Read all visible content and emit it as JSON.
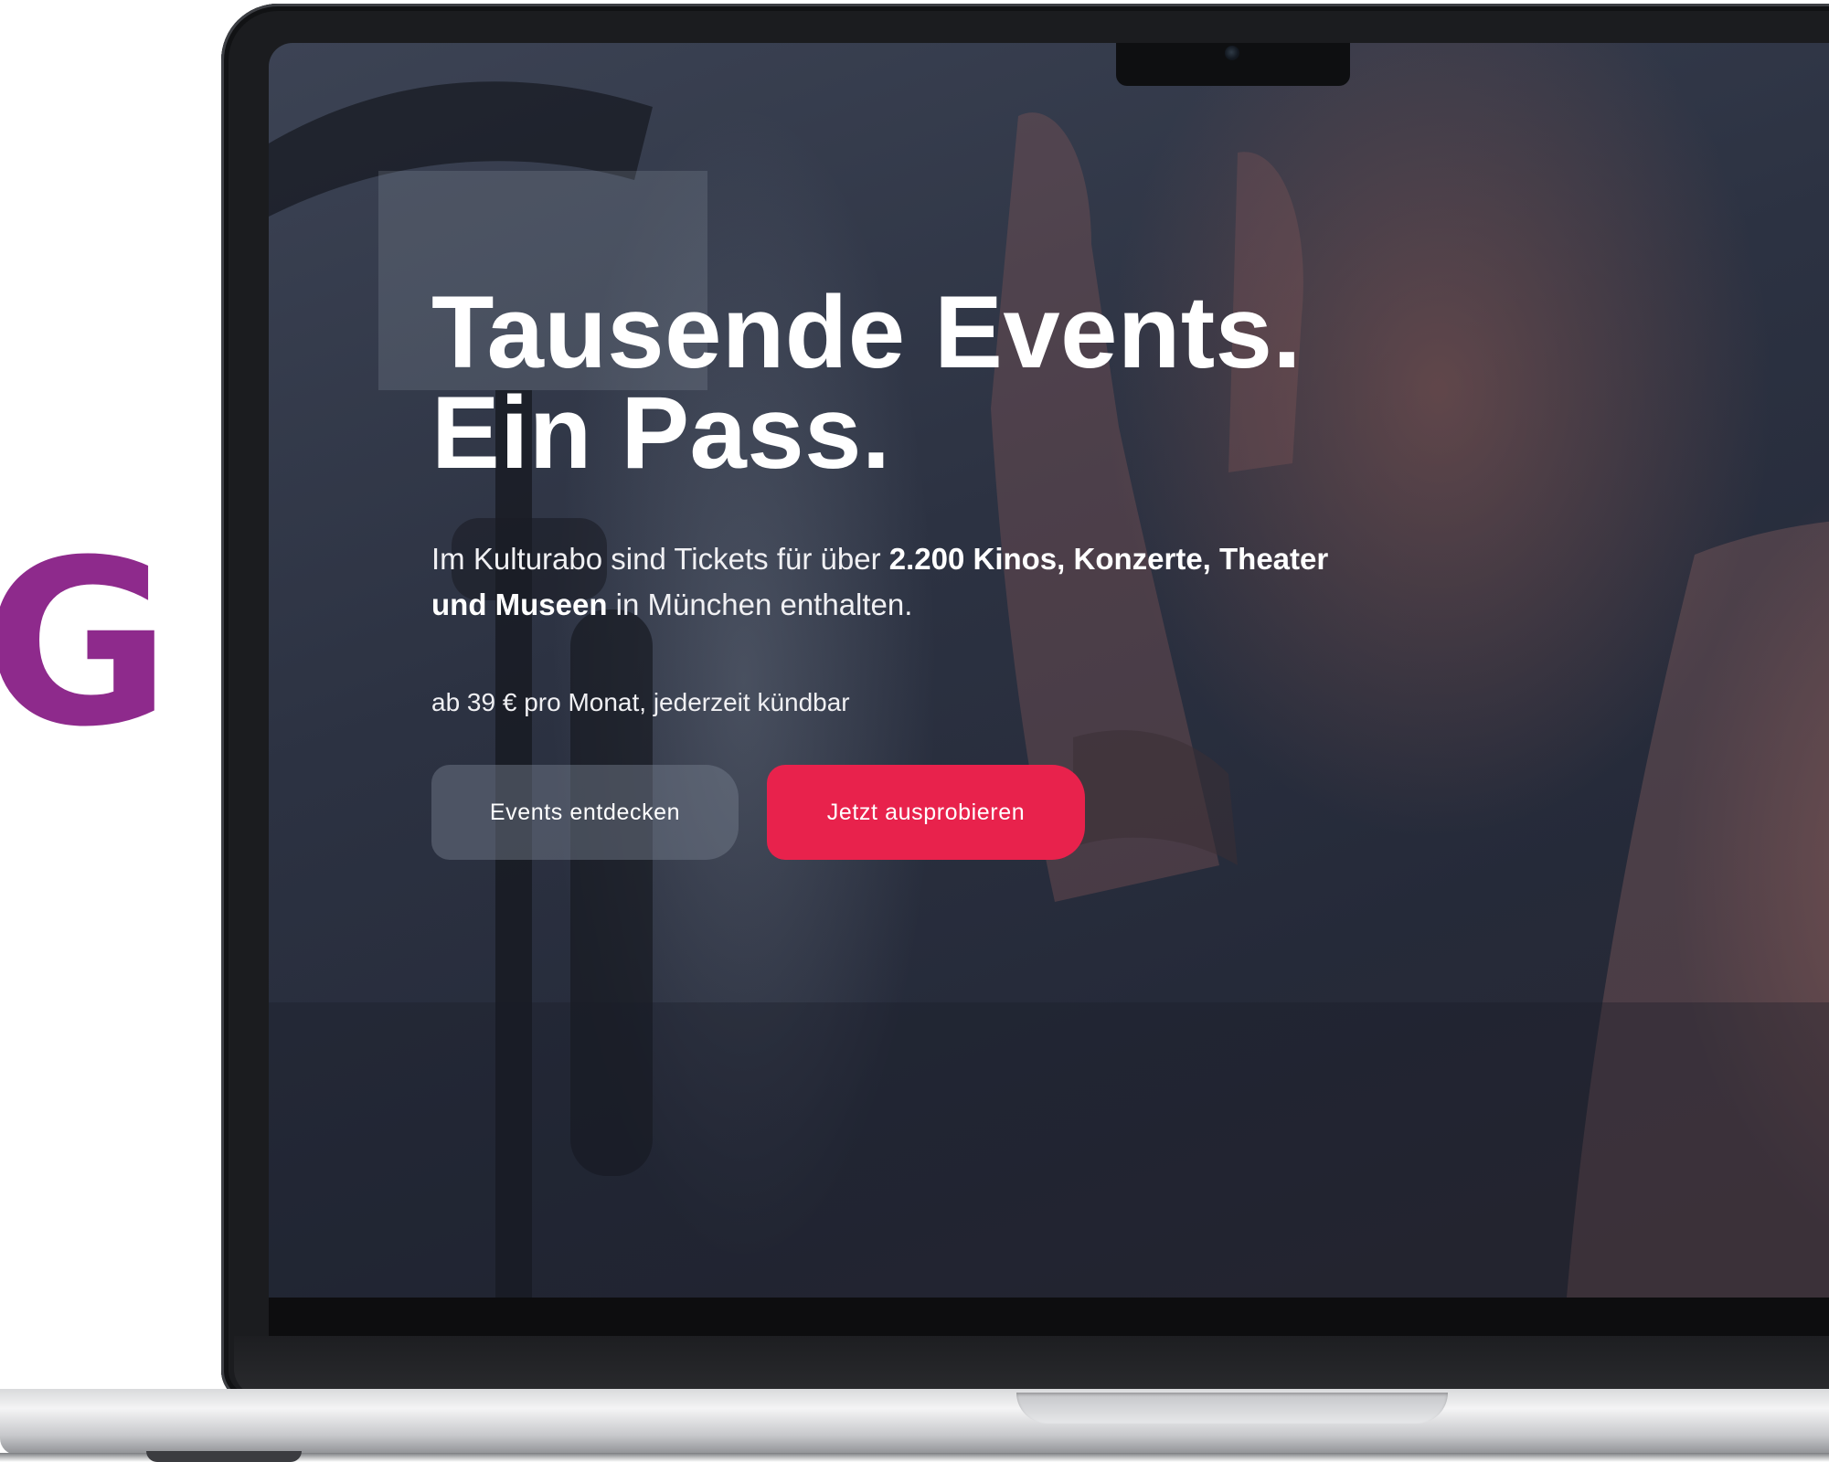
{
  "brand": {
    "logo_glyph": "G",
    "logo_color": "#8e2a8c"
  },
  "hero": {
    "headline_line1": "Tausende Events.",
    "headline_line2": "Ein Pass.",
    "sub_part1": "Im Kulturabo sind Tickets für über ",
    "sub_bold1": "2.200 Kinos, Konzerte, Theater und Museen",
    "sub_part2": " in München enthalten.",
    "price_note": "ab 39 € pro Monat, jederzeit kündbar"
  },
  "buttons": {
    "discover_label": "Events entdecken",
    "try_label": "Jetzt ausprobieren"
  },
  "colors": {
    "accent": "#e8224c",
    "secondary_button": "#5f6678"
  }
}
